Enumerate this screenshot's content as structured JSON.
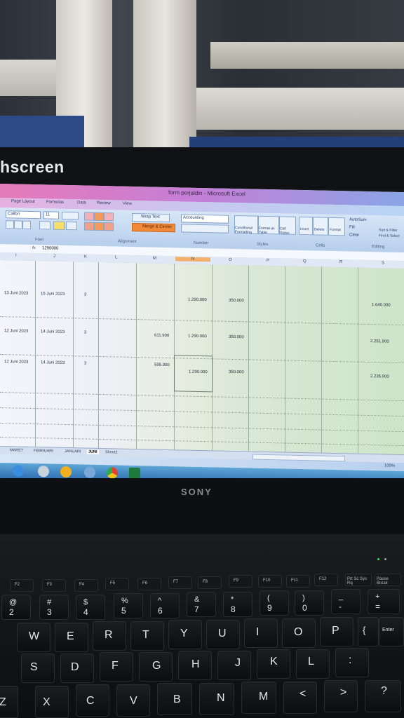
{
  "brand_bezel": "hscreen",
  "laptop_logo": "SONY",
  "excel": {
    "title": "form perjaldin - Microsoft Excel",
    "tabs": [
      "Page Layout",
      "Formulas",
      "Data",
      "Review",
      "View"
    ],
    "ribbon": {
      "font_name": "Calibri",
      "font_size": "11",
      "wrap_text": "Wrap Text",
      "merge_center": "Merge & Center",
      "number_format": "Accounting",
      "conditional_formatting": "Conditional Formatting",
      "format_as_table": "Format as Table",
      "cell_styles": "Cell Styles",
      "insert": "Insert",
      "delete": "Delete",
      "format": "Format",
      "autosum": "AutoSum",
      "fill": "Fill",
      "clear": "Clear",
      "sort_filter": "Sort & Filter",
      "find_select": "Find & Select",
      "groups": [
        "Font",
        "Alignment",
        "Number",
        "Styles",
        "Cells",
        "Editing"
      ]
    },
    "formula_bar": {
      "fx": "fx",
      "value": "1290000"
    },
    "columns": [
      "I",
      "J",
      "K",
      "L",
      "M",
      "N",
      "O",
      "P",
      "Q",
      "R",
      "S"
    ],
    "selected_column": "N",
    "rows": [
      {
        "i": "13 Juni 2023",
        "j": "15 Juni 2023",
        "k": "3",
        "m": "",
        "n": "1.290.000",
        "o": "350.000",
        "s": "1.640.000"
      },
      {
        "i": "12 Juni 2023",
        "j": "14 Juni 2023",
        "k": "3",
        "m": "611.900",
        "n": "1.290.000",
        "o": "350.000",
        "s": "2.251.900"
      },
      {
        "i": "12 Juni 2023",
        "j": "14 Juni 2023",
        "k": "3",
        "m": "595.900",
        "n": "1.290.000",
        "o": "350.000",
        "s": "2.235.900"
      }
    ],
    "sheet_tabs": [
      "MARET",
      "FEBRUARI",
      "JANUARI",
      "JUNI",
      "Sheet2"
    ],
    "active_sheet": "JUNI",
    "zoom": "100%"
  },
  "keyboard": {
    "fkeys": [
      "F2",
      "F3",
      "F4",
      "F5",
      "F6",
      "F7",
      "F8",
      "F9",
      "F10",
      "F11",
      "F12",
      "Prt Sc Sys Rq",
      "Pause Break"
    ],
    "number_row": [
      {
        "top": "@",
        "main": "2"
      },
      {
        "top": "#",
        "main": "3"
      },
      {
        "top": "$",
        "main": "4"
      },
      {
        "top": "%",
        "main": "5"
      },
      {
        "top": "^",
        "main": "6"
      },
      {
        "top": "&",
        "main": "7"
      },
      {
        "top": "*",
        "main": "8"
      },
      {
        "top": "(",
        "main": "9"
      },
      {
        "top": ")",
        "main": "0"
      },
      {
        "top": "_",
        "main": "-"
      },
      {
        "top": "+",
        "main": "="
      }
    ],
    "row_q": [
      "W",
      "E",
      "R",
      "T",
      "Y",
      "U",
      "I",
      "O",
      "P",
      "{",
      "Enter"
    ],
    "row_a": [
      "S",
      "D",
      "F",
      "G",
      "H",
      "J",
      "K",
      "L",
      ":"
    ],
    "row_z": [
      "Z",
      "X",
      "C",
      "V",
      "B",
      "N",
      "M",
      "<",
      ">",
      "?"
    ]
  }
}
